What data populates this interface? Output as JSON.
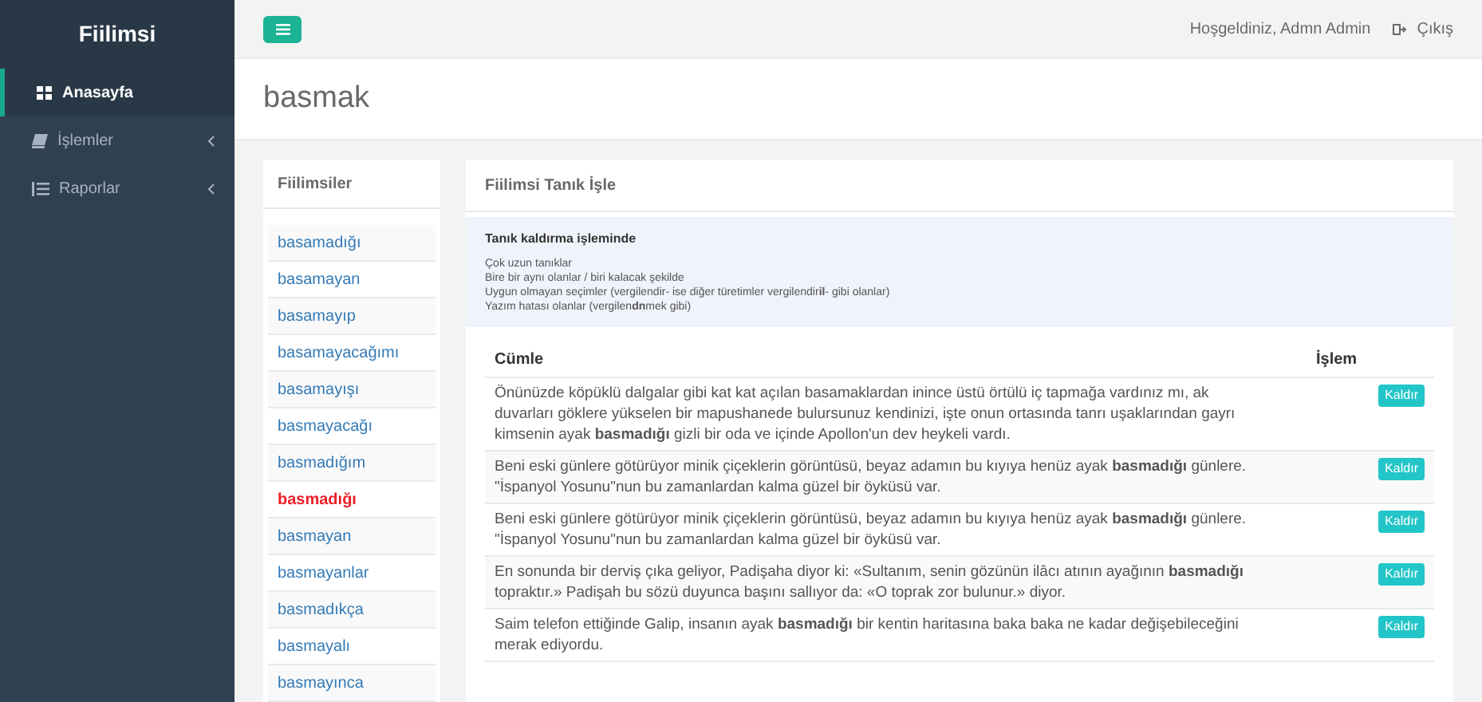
{
  "sidebar": {
    "brand": "Fiilimsi",
    "items": [
      {
        "label": "Anasayfa",
        "kind": "grid",
        "selected": true,
        "has_submenu": false
      },
      {
        "label": "İşlemler",
        "kind": "book",
        "selected": false,
        "has_submenu": true
      },
      {
        "label": "Raporlar",
        "kind": "list",
        "selected": false,
        "has_submenu": true
      }
    ]
  },
  "top_bar": {
    "greeting": "Hoşgeldiniz, Admn Admin",
    "logout": "Çıkış"
  },
  "page_title": "basmak",
  "word_list": {
    "title": "Fiilimsiler",
    "items": [
      {
        "label": "basamadığı",
        "selected": false
      },
      {
        "label": "basamayan",
        "selected": false
      },
      {
        "label": "basamayıp",
        "selected": false
      },
      {
        "label": "basamayacağımı",
        "selected": false
      },
      {
        "label": "basamayışı",
        "selected": false
      },
      {
        "label": "basmayacağı",
        "selected": false
      },
      {
        "label": "basmadığım",
        "selected": false
      },
      {
        "label": "basmadığı",
        "selected": true
      },
      {
        "label": "basmayan",
        "selected": false
      },
      {
        "label": "basmayanlar",
        "selected": false
      },
      {
        "label": "basmadıkça",
        "selected": false
      },
      {
        "label": "basmayalı",
        "selected": false
      },
      {
        "label": "basmayınca",
        "selected": false
      }
    ]
  },
  "examples_panel": {
    "title": "Fiilimsi Tanık İşle",
    "note": {
      "heading": "Tanık kaldırma işleminde",
      "lines": [
        "Çok uzun tanıklar",
        "Bire bir aynı olanlar / biri kalacak şekilde",
        "Uygun olmayan seçimler (vergilendir- ise diğer türetimler vergilendir**il**- gibi olanlar)",
        "Yazım hatası olanlar (vergilen**dn**mek gibi)"
      ]
    },
    "columns": [
      "Cümle",
      "İşlem"
    ],
    "rows": [
      {
        "sentence": "Önünüzde köpüklü dalgalar gibi kat kat açılan basamaklardan inince üstü örtülü iç tapmağa vardınız mı, ak duvarları göklere yükselen bir mapushanede bulursunuz kendinizi, işte onun ortasında tanrı uşaklarından gayrı kimsenin ayak **basmadığı** gizli bir oda ve içinde Apollon'un dev heykeli vardı.",
        "action": "Kaldır"
      },
      {
        "sentence": "Beni eski günlere götürüyor minik çiçeklerin görüntüsü, beyaz adamın bu kıyıya henüz ayak **basmadığı** günlere. \"İspanyol Yosunu\"nun bu zamanlardan kalma güzel bir öyküsü var.",
        "action": "Kaldır"
      },
      {
        "sentence": "Beni eski günlere götürüyor minik çiçeklerin görüntüsü, beyaz adamın bu kıyıya henüz ayak **basmadığı** günlere. \"İspanyol Yosunu\"nun bu zamanlardan kalma güzel bir öyküsü var.",
        "action": "Kaldır"
      },
      {
        "sentence": "En sonunda bir derviş çıka geliyor, Padişaha diyor ki: «Sultanım, senin gözünün ilâcı atının ayağının **basmadığı** topraktır.» Padişah bu sözü duyunca başını sallıyor da: «O toprak zor bulunur.» diyor.",
        "action": "Kaldır"
      },
      {
        "sentence": "Saim telefon ettiğinde Galip, insanın ayak **basmadığı** bir kentin haritasına baka baka ne kadar değişebileceğini merak ediyordu.",
        "action": "Kaldır"
      }
    ]
  }
}
